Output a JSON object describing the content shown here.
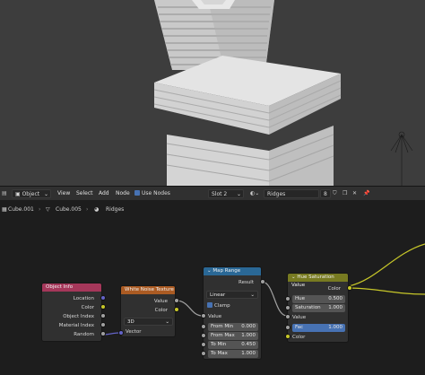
{
  "header": {
    "object_mode": "Object",
    "menu": [
      "View",
      "Select",
      "Add",
      "Node"
    ],
    "use_nodes_label": "Use Nodes",
    "slot": "Slot 2",
    "material_name": "Ridges",
    "user_count": "8"
  },
  "breadcrumb": {
    "items": [
      "Cube.001",
      "Cube.005",
      "Ridges"
    ]
  },
  "nodes": {
    "object_info": {
      "title": "Object Info",
      "outputs": [
        "Location",
        "Color",
        "Object Index",
        "Material Index",
        "Random"
      ]
    },
    "white_noise": {
      "title": "White Noise Texture",
      "outputs": [
        "Value",
        "Color"
      ],
      "dimensions": "3D",
      "input": "Vector"
    },
    "map_range": {
      "title": "Map Range",
      "output": "Result",
      "interpolation": "Linear",
      "clamp_label": "Clamp",
      "value_label": "Value",
      "fields": [
        {
          "label": "From Min",
          "value": "0.000"
        },
        {
          "label": "From Max",
          "value": "1.000"
        },
        {
          "label": "To Min",
          "value": "0.450"
        },
        {
          "label": "To Max",
          "value": "1.000"
        }
      ]
    },
    "hue_sat": {
      "title": "Hue Saturation Value",
      "output": "Color",
      "fields": [
        {
          "label": "Hue",
          "value": "0.500"
        },
        {
          "label": "Saturation",
          "value": "1.000"
        },
        {
          "label": "Value",
          "value": ""
        },
        {
          "label": "Fac",
          "value": "1.000"
        },
        {
          "label": "Color",
          "value": ""
        }
      ]
    }
  },
  "colors": {
    "object_info_header": "#a5375a",
    "white_noise_header": "#ab5b23",
    "map_range_header": "#2a6896",
    "hue_sat_header": "#777a21",
    "socket_float": "#a1a1a1",
    "socket_color": "#c7c729",
    "socket_vector": "#6363c7",
    "accent": "#4772b3"
  }
}
